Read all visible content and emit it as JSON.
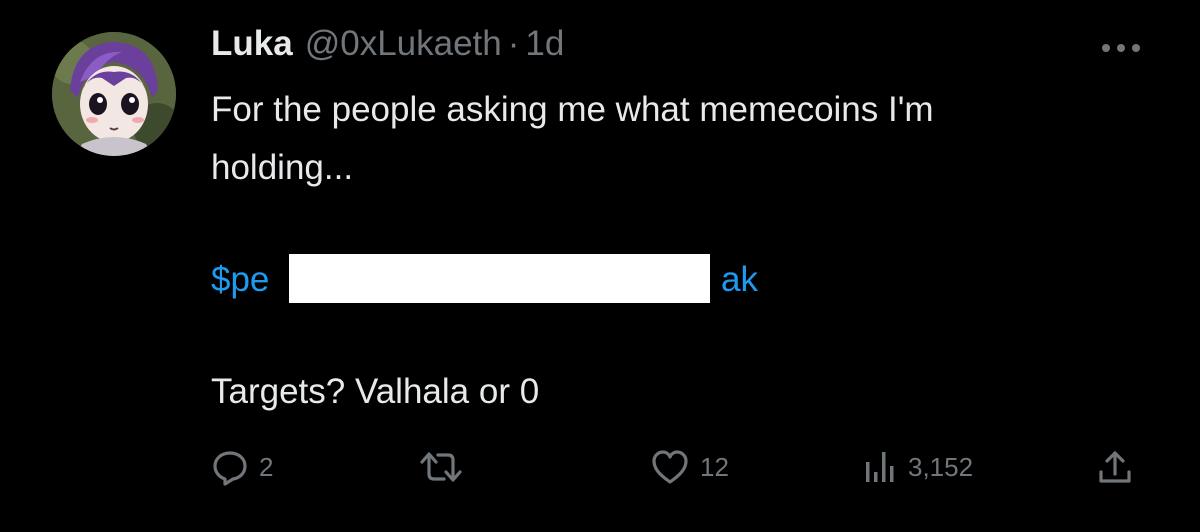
{
  "tweet": {
    "author": {
      "display_name": "Luka",
      "handle": "@0xLukaeth",
      "separator": "·",
      "timestamp": "1d"
    },
    "text_lines": [
      "For the people asking me what memecoins I'm",
      "holding...",
      "Targets? Valhala or 0"
    ],
    "cashtag_start": "$pe",
    "cashtag_end": "ak",
    "actions": {
      "replies": "2",
      "reposts": "",
      "likes": "12",
      "views": "3,152"
    }
  },
  "colors": {
    "background": "#000000",
    "text": "#e7e9ea",
    "secondary": "#71767b",
    "link": "#1d9bf0"
  },
  "icons": [
    "avatar-image",
    "more-icon",
    "reply-icon",
    "repost-icon",
    "like-icon",
    "views-icon",
    "share-icon"
  ]
}
